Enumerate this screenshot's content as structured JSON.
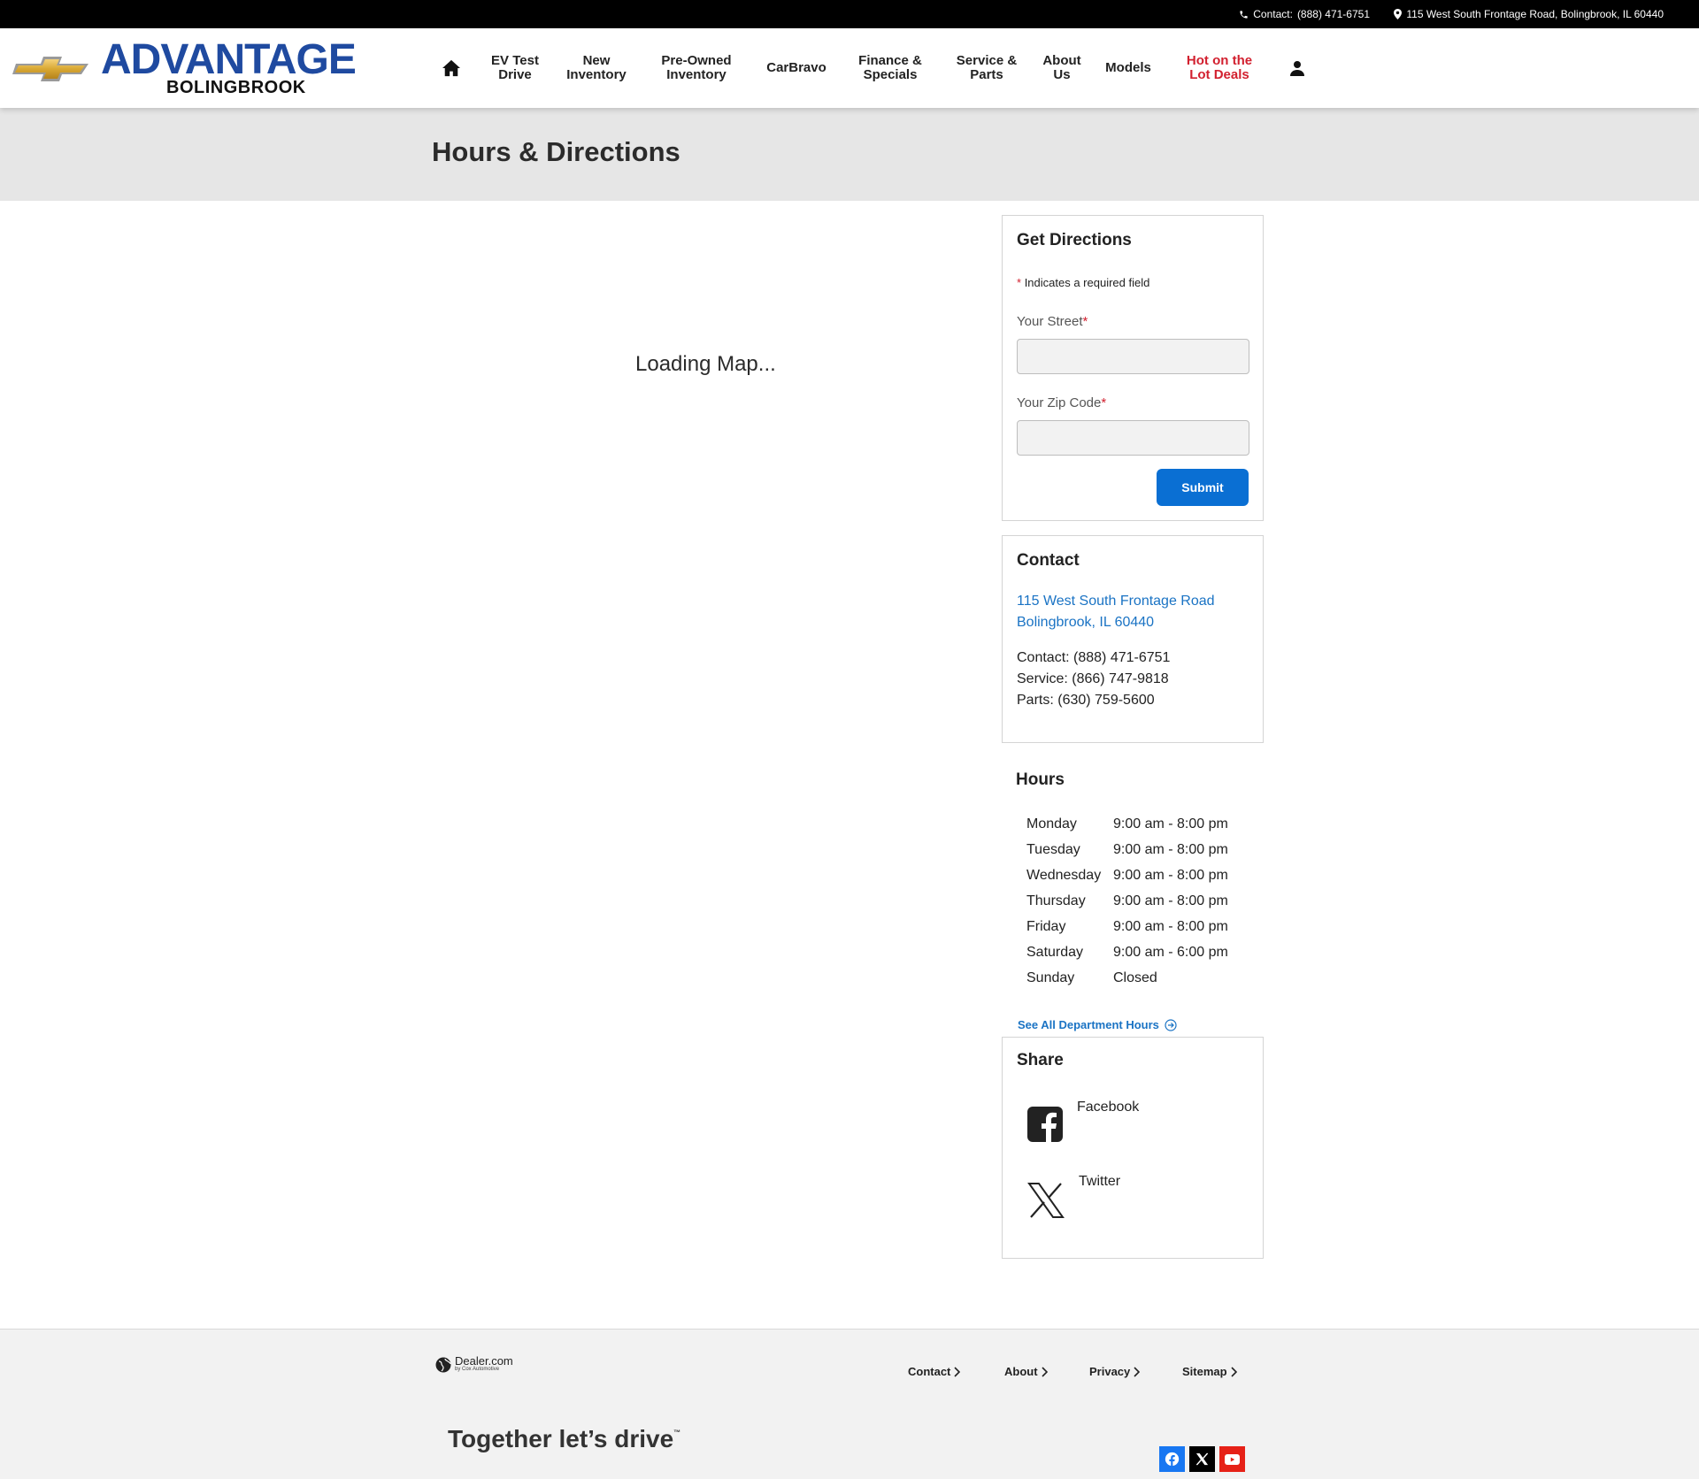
{
  "topbar": {
    "contact_label": "Contact:",
    "contact_phone": "(888) 471-6751",
    "address": "115 West South Frontage Road, Bolingbrook, IL 60440"
  },
  "brand": {
    "name": "ADVANTAGE",
    "location": "BOLINGBROOK",
    "color": "#1f4aa0"
  },
  "nav": {
    "items": [
      {
        "label": "EV Test\nDrive"
      },
      {
        "label": "New\nInventory"
      },
      {
        "label": "Pre-Owned\nInventory"
      },
      {
        "label": "CarBravo"
      },
      {
        "label": "Finance &\nSpecials"
      },
      {
        "label": "Service &\nParts"
      },
      {
        "label": "About\nUs"
      },
      {
        "label": "Models"
      },
      {
        "label": "Hot on the\nLot Deals"
      }
    ],
    "icons": {
      "home": "home-icon",
      "account": "user-icon"
    }
  },
  "page": {
    "title": "Hours & Directions",
    "map_status": "Loading Map..."
  },
  "directions": {
    "title": "Get Directions",
    "required_marker": "*",
    "required_note": "Indicates a required field",
    "street_label": "Your Street",
    "street_value": "",
    "zip_label": "Your Zip Code",
    "zip_value": "",
    "submit_label": "Submit",
    "accent_color": "#0a6fd3"
  },
  "contact": {
    "title": "Contact",
    "address_line1": "115 West South Frontage Road",
    "address_line2": "Bolingbrook, IL 60440",
    "lines": [
      "Contact: (888) 471-6751",
      "Service: (866) 747-9818",
      "Parts: (630) 759-5600"
    ]
  },
  "hours": {
    "title": "Hours",
    "rows": [
      {
        "day": "Monday",
        "time": "9:00 am - 8:00 pm"
      },
      {
        "day": "Tuesday",
        "time": "9:00 am - 8:00 pm"
      },
      {
        "day": "Wednesday",
        "time": "9:00 am - 8:00 pm"
      },
      {
        "day": "Thursday",
        "time": "9:00 am - 8:00 pm"
      },
      {
        "day": "Friday",
        "time": "9:00 am - 8:00 pm"
      },
      {
        "day": "Saturday",
        "time": "9:00 am - 6:00 pm"
      },
      {
        "day": "Sunday",
        "time": "Closed"
      }
    ],
    "department_link": "See All Department Hours"
  },
  "share": {
    "title": "Share",
    "facebook": "Facebook",
    "twitter": "Twitter"
  },
  "footer": {
    "dealer_brand": "Dealer.com",
    "dealer_sub": "by Cox Automotive",
    "links": [
      "Contact",
      "About",
      "Privacy",
      "Sitemap"
    ],
    "tagline": "Together let’s drive",
    "tagline_mark": "™",
    "social": [
      {
        "icon": "facebook-icon",
        "color": "#1877f2"
      },
      {
        "icon": "x-icon",
        "color": "#000000"
      },
      {
        "icon": "youtube-icon",
        "color": "#e62117"
      }
    ]
  }
}
